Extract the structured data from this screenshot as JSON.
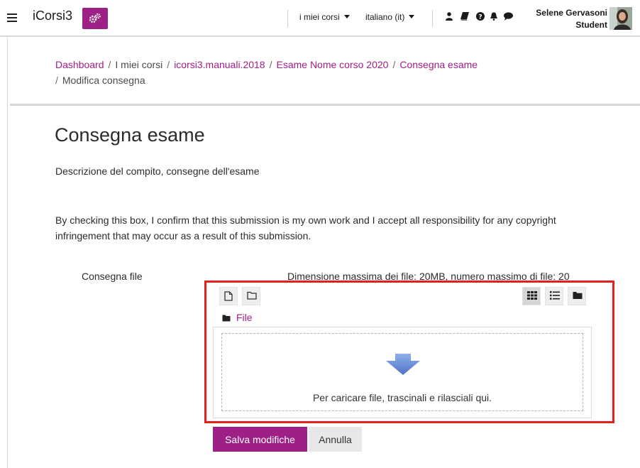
{
  "navbar": {
    "brand": "iCorsi3",
    "my_courses": "i miei corsi",
    "language": "italiano (it)",
    "user_name": "Selene Gervasoni",
    "user_role": "Student",
    "icons": [
      "user-icon",
      "book-icon",
      "question-icon",
      "bell-icon",
      "chat-icon"
    ]
  },
  "breadcrumb": {
    "items": [
      "Dashboard",
      "I miei corsi",
      "icorsi3.manuali.2018",
      "Esame Nome corso 2020",
      "Consegna esame"
    ],
    "current": "Modifica consegna",
    "separator": "/"
  },
  "page": {
    "title": "Consegna esame",
    "description": "Descrizione del compito, consegne dell'esame",
    "statement": "By checking this box, I confirm that this submission is my own work and I accept all responsibility for any copyright infringement that may occur as a result of this submission."
  },
  "filepicker": {
    "label": "Consegna file",
    "limits": "Dimensione massima dei file: 20MB, numero massimo di file: 20",
    "folder": "File",
    "drop_text": "Per caricare file, trascinali e rilasciali qui."
  },
  "buttons": {
    "save": "Salva modifiche",
    "cancel": "Annulla"
  },
  "colors": {
    "accent": "#9e1f85",
    "highlight_box": "#e3201b",
    "drop_arrow": "#6f8fd4"
  }
}
